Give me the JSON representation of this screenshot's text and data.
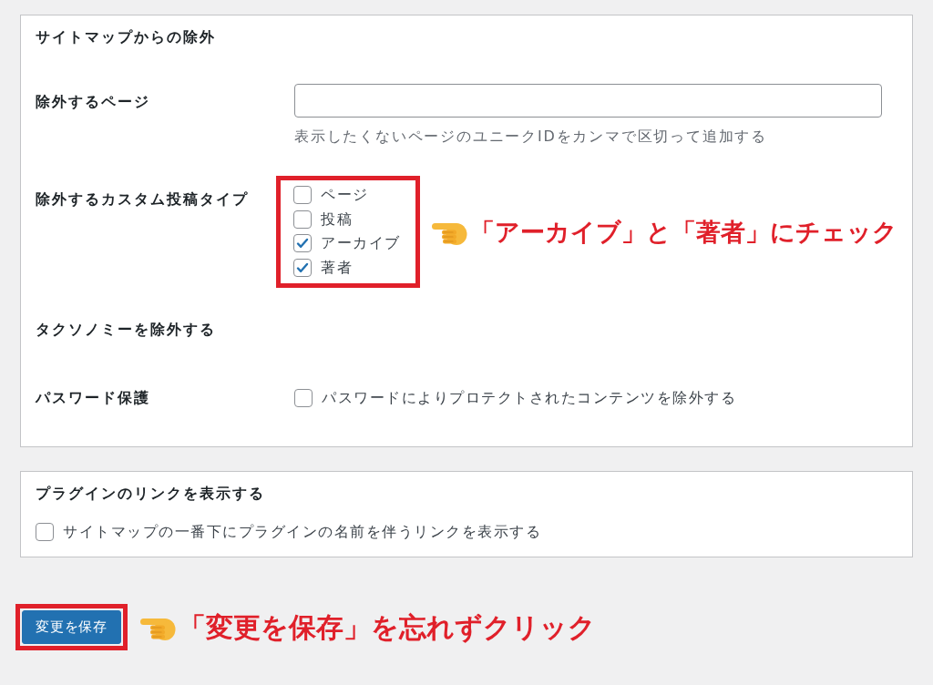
{
  "sections": [
    {
      "title": "サイトマップからの除外",
      "rows": [
        {
          "kind": "text-input",
          "label": "除外するページ",
          "description": "表示したくないページのユニークIDをカンマで区切って追加する"
        },
        {
          "kind": "checkbox-list",
          "label": "除外するカスタム投稿タイプ",
          "highlighted": true,
          "options": [
            {
              "label": "ページ",
              "checked": false
            },
            {
              "label": "投稿",
              "checked": false
            },
            {
              "label": "アーカイブ",
              "checked": true
            },
            {
              "label": "著者",
              "checked": true
            }
          ],
          "annotation": "「アーカイブ」と「著者」にチェック"
        },
        {
          "kind": "empty",
          "label": "タクソノミーを除外する"
        },
        {
          "kind": "checkbox-list",
          "label": "パスワード保護",
          "highlighted": false,
          "options": [
            {
              "label": "パスワードによりプロテクトされたコンテンツを除外する",
              "checked": false
            }
          ]
        }
      ]
    },
    {
      "title": "プラグインのリンクを表示する",
      "rows": [
        {
          "kind": "checkbox-list",
          "highlighted": false,
          "options": [
            {
              "label": "サイトマップの一番下にプラグインの名前を伴うリンクを表示する",
              "checked": false
            }
          ]
        }
      ]
    }
  ],
  "save_button": {
    "label": "変更を保存",
    "highlighted": true,
    "annotation": "「変更を保存」を忘れずクリック"
  }
}
